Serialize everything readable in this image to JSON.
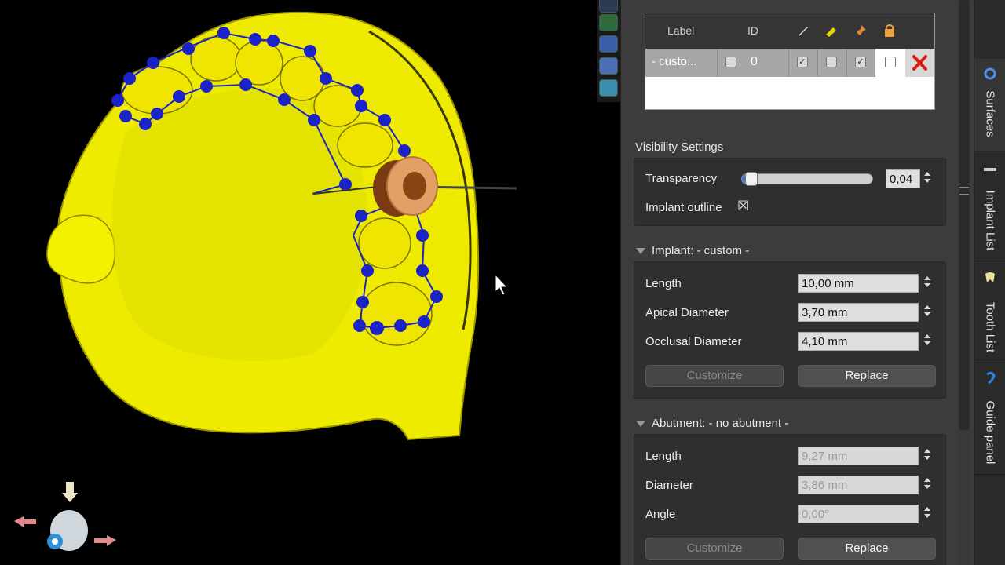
{
  "table": {
    "columns": {
      "label": "Label",
      "id": "ID"
    },
    "row": {
      "label": "- custo...",
      "id": "0"
    }
  },
  "visibility": {
    "title": "Visibility Settings",
    "transparency_label": "Transparency",
    "transparency_value": "0,04",
    "transparency_level": 0.04,
    "implant_outline_label": "Implant outline",
    "implant_outline_checked": "☒"
  },
  "implant": {
    "title": "Implant: - custom -",
    "length_label": "Length",
    "length_value": "10,00 mm",
    "apical_label": "Apical Diameter",
    "apical_value": "3,70 mm",
    "occlusal_label": "Occlusal Diameter",
    "occlusal_value": "4,10 mm",
    "customize": "Customize",
    "replace": "Replace"
  },
  "abutment": {
    "title": "Abutment: - no abutment -",
    "length_label": "Length",
    "length_value": "9,27 mm",
    "diameter_label": "Diameter",
    "diameter_value": "3,86 mm",
    "angle_label": "Angle",
    "angle_value": "0,00°",
    "customize": "Customize",
    "replace": "Replace"
  },
  "sidetabs": [
    "Surfaces",
    "Implant List",
    "Tooth List",
    "Guide panel"
  ],
  "colors": {
    "model": "#f2f000",
    "curve": "#1f2fb8",
    "implant": "#e3a066"
  }
}
